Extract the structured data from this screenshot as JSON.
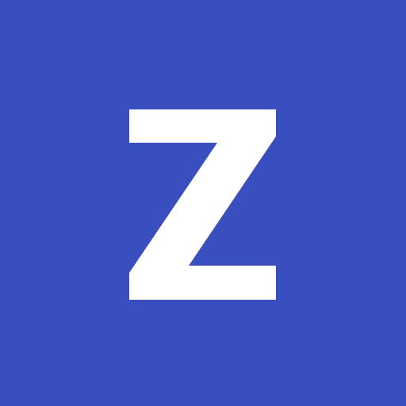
{
  "icon": {
    "letter": "Z",
    "background_color": "#3a4fbf",
    "letter_color": "#ffffff"
  }
}
